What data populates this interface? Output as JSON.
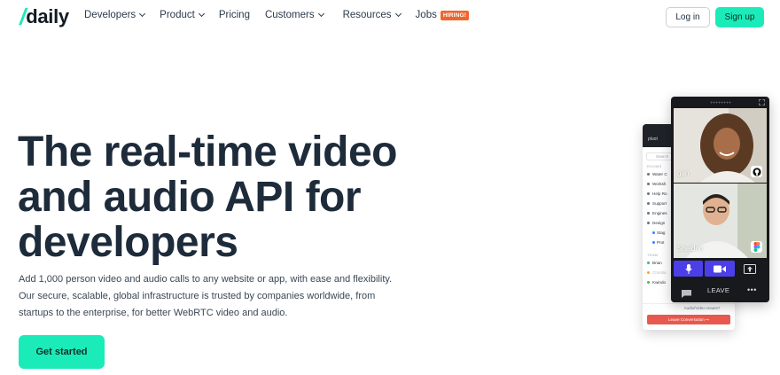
{
  "brand": {
    "slash": "/",
    "name": "daily",
    "accent": "#1bebb9"
  },
  "nav": {
    "items": [
      {
        "label": "Developers",
        "dropdown": true
      },
      {
        "label": "Product",
        "dropdown": true
      },
      {
        "label": "Pricing",
        "dropdown": false
      },
      {
        "label": "Customers",
        "dropdown": true
      },
      {
        "label": "Resources",
        "dropdown": true
      },
      {
        "label": "Jobs",
        "dropdown": false
      }
    ],
    "jobs_badge": "HIRING!",
    "login": "Log in",
    "signup": "Sign up"
  },
  "hero": {
    "title_line1": "The real-time video",
    "title_line2": "and audio API for",
    "title_line3": "developers",
    "desc_line1": "Add 1,000 person video and audio calls to any website or app, with ease and flexibility.",
    "desc_line2": "Our secure, scalable, global infrastructure is trusted by companies worldwide, from",
    "desc_line3": "startups to the enterprise, for better WebRTC video and audio.",
    "cta": "Get started"
  },
  "mockup": {
    "sidebar": {
      "workspace": "pluot",
      "search": "Search",
      "rooms_title": "ROOMS",
      "rooms": [
        "Water C",
        "Worksh",
        "Help Ro",
        "Support",
        "Engines",
        "Design"
      ],
      "subrooms": [
        "Stag",
        "Prot"
      ],
      "team_title": "TEAM",
      "team": [
        "Brian",
        "Christia",
        "Kwindo"
      ],
      "question": "Audio/Video issues?",
      "leave": "Leave Conversation"
    },
    "call": {
      "participant1": "gan",
      "participant2": "Sheldon",
      "leave": "LEAVE",
      "more": "•••"
    }
  }
}
